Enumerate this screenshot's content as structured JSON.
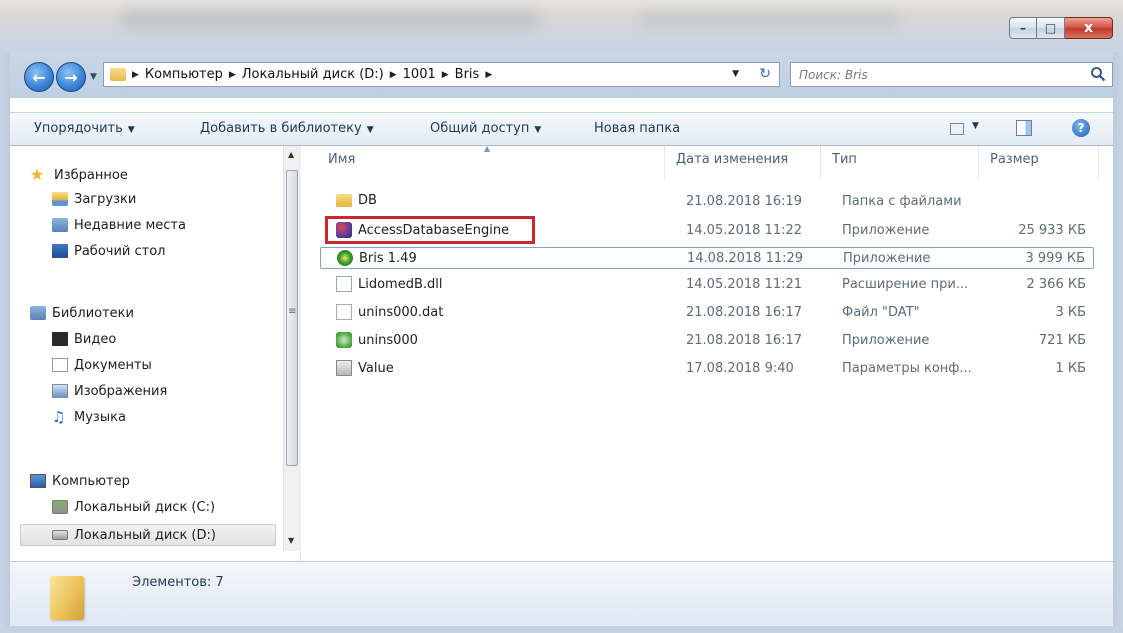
{
  "window": {
    "caption_min": "–",
    "caption_max": "□",
    "caption_close": "x"
  },
  "address": {
    "crumbs": [
      "Компьютер",
      "Локальный диск (D:)",
      "1001",
      "Bris"
    ]
  },
  "search": {
    "placeholder": "Поиск: Bris"
  },
  "toolbar": {
    "organize": "Упорядочить",
    "add_library": "Добавить в библиотеку",
    "share": "Общий доступ",
    "new_folder": "Новая папка"
  },
  "nav": {
    "favorites": "Избранное",
    "downloads": "Загрузки",
    "recent": "Недавние места",
    "desktop": "Рабочий стол",
    "libraries": "Библиотеки",
    "video": "Видео",
    "documents": "Документы",
    "images": "Изображения",
    "music": "Музыка",
    "computer": "Компьютер",
    "disk_c": "Локальный диск (C:)",
    "disk_d": "Локальный диск (D:)"
  },
  "columns": {
    "name": "Имя",
    "date": "Дата изменения",
    "type": "Тип",
    "size": "Размер"
  },
  "files": [
    {
      "name": "DB",
      "date": "21.08.2018 16:19",
      "type": "Папка с файлами",
      "size": "",
      "icon": "folder-icon"
    },
    {
      "name": "AccessDatabaseEngine",
      "date": "14.05.2018 11:22",
      "type": "Приложение",
      "size": "25 933 КБ",
      "icon": "setup-app-icon"
    },
    {
      "name": "Bris 1.49",
      "date": "14.08.2018 11:29",
      "type": "Приложение",
      "size": "3 999 КБ",
      "icon": "bris-app-icon"
    },
    {
      "name": "LidomedB.dll",
      "date": "14.05.2018 11:21",
      "type": "Расширение при...",
      "size": "2 366 КБ",
      "icon": "dll-file-icon"
    },
    {
      "name": "unins000.dat",
      "date": "21.08.2018 16:17",
      "type": "Файл \"DAT\"",
      "size": "3 КБ",
      "icon": "dat-file-icon"
    },
    {
      "name": "unins000",
      "date": "21.08.2018 16:17",
      "type": "Приложение",
      "size": "721 КБ",
      "icon": "uninstall-app-icon"
    },
    {
      "name": "Value",
      "date": "17.08.2018 9:40",
      "type": "Параметры конф...",
      "size": "1 КБ",
      "icon": "config-file-icon"
    }
  ],
  "status": {
    "count": "Элементов: 7"
  },
  "colors": {
    "highlight_box": "#c8282e",
    "toolbar_text": "#1e395b"
  }
}
